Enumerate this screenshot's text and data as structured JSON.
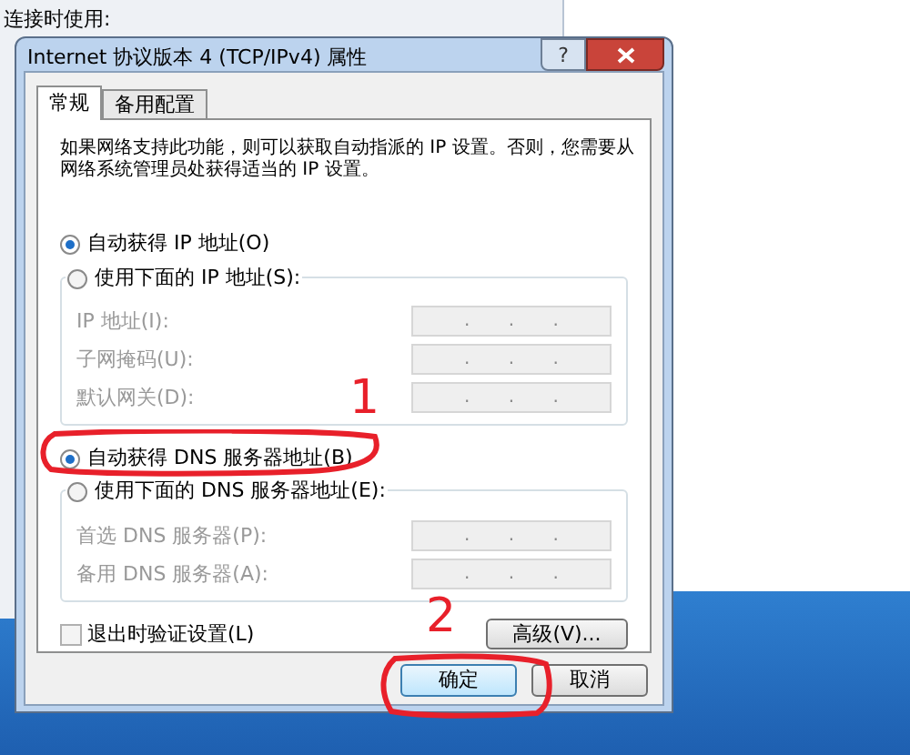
{
  "background_window": {
    "label": "连接时使用:"
  },
  "dialog": {
    "title": "Internet 协议版本 4 (TCP/IPv4) 属性",
    "help_button": "?"
  },
  "tabs": [
    {
      "label": "常规",
      "selected": true
    },
    {
      "label": "备用配置",
      "selected": false
    }
  ],
  "description": "如果网络支持此功能，则可以获取自动指派的 IP 设置。否则，您需要从网络系统管理员处获得适当的 IP 设置。",
  "ip_options": [
    {
      "label": "自动获得 IP 地址(O)",
      "selected": true
    },
    {
      "label": "使用下面的 IP 地址(S):",
      "selected": false
    }
  ],
  "ip_fields": {
    "disabled": true,
    "items": [
      {
        "label": "IP 地址(I):",
        "value": ". . ."
      },
      {
        "label": "子网掩码(U):",
        "value": ". . ."
      },
      {
        "label": "默认网关(D):",
        "value": ". . ."
      }
    ]
  },
  "dns_options": [
    {
      "label": "自动获得 DNS 服务器地址(B)",
      "selected": true
    },
    {
      "label": "使用下面的 DNS 服务器地址(E):",
      "selected": false
    }
  ],
  "dns_fields": {
    "disabled": true,
    "items": [
      {
        "label": "首选 DNS 服务器(P):",
        "value": ". . ."
      },
      {
        "label": "备用 DNS 服务器(A):",
        "value": ". . ."
      }
    ]
  },
  "validate_checkbox": {
    "label": "退出时验证设置(L)",
    "checked": false
  },
  "advanced_button": "高级(V)...",
  "footer_buttons": [
    {
      "label": "确定",
      "selected": true
    },
    {
      "label": "取消",
      "selected": false
    }
  ],
  "annotations": [
    "1",
    "2"
  ]
}
